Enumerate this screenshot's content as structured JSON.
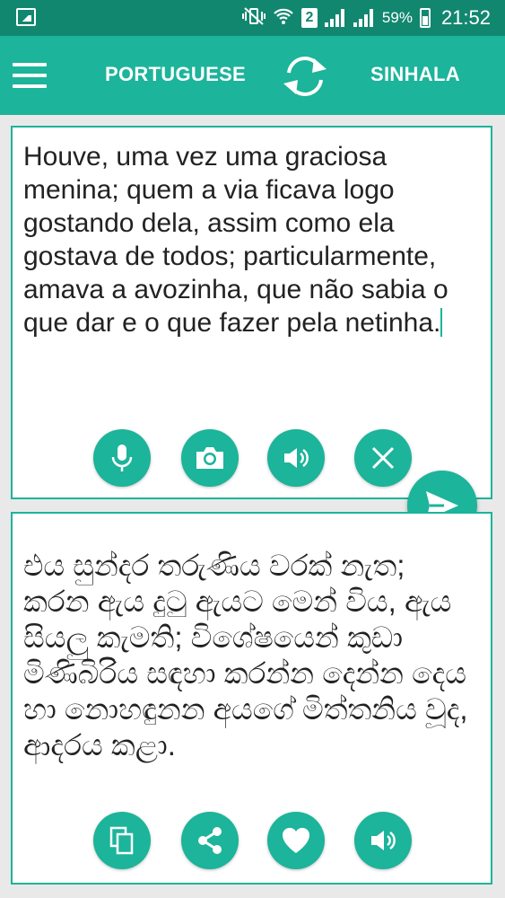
{
  "status_bar": {
    "sim_slot": "2",
    "battery_percent": "59%",
    "time": "21:52",
    "icons": [
      "gallery-icon",
      "vibrate-mute-icon",
      "wifi-icon",
      "signal-icon",
      "battery-charging-icon"
    ]
  },
  "app_bar": {
    "menu_icon": "hamburger-menu-icon",
    "source_language": "PORTUGUESE",
    "swap_icon": "swap-languages-icon",
    "target_language": "SINHALA"
  },
  "source_panel": {
    "text": "Houve, uma vez uma graciosa menina; quem a via ficava logo gostando dela, assim como ela gostava de todos; particularmente, amava a avozinha, que não sabia o que dar e o que fazer pela netinha.",
    "buttons": [
      "microphone-icon",
      "camera-icon",
      "speaker-icon",
      "clear-icon"
    ]
  },
  "send_button": {
    "icon": "send-icon"
  },
  "target_panel": {
    "text": "එය සුන්දර තරුණිය වරක් නැත; කරන ඇය දුටු ඇයට මෙන් විය, ඇය සියලු කැමති; විශේෂයෙන් කුඩා මිණිබිරිය සඳහා කරන්න දෙන්න දෙය හා නොහඳුනන අයගේ මිත්තනිය වූද, ආදරය කළා.",
    "buttons": [
      "copy-icon",
      "share-icon",
      "favorite-icon",
      "speaker-icon"
    ]
  },
  "colors": {
    "status_bar": "#12876f",
    "primary": "#1cb49a",
    "background": "#e9e9e9"
  }
}
